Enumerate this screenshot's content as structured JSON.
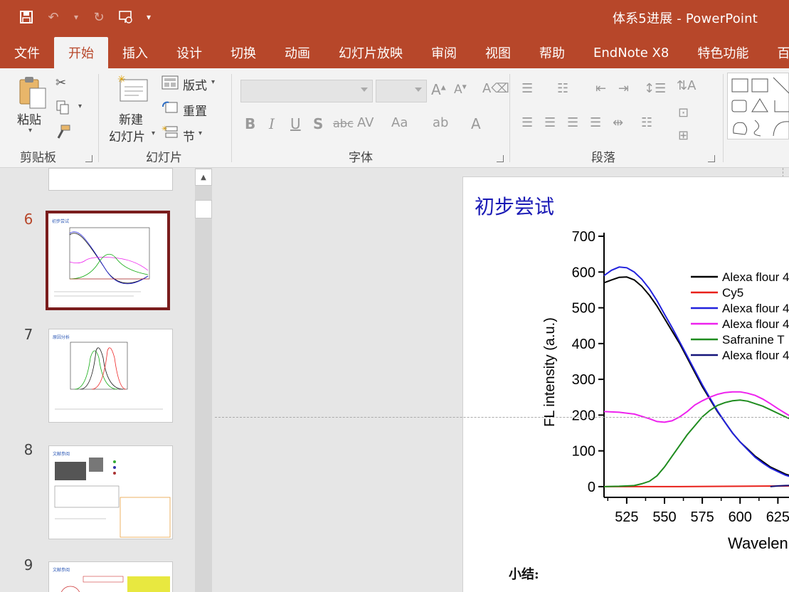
{
  "window": {
    "title": "体系5进展  -  PowerPoint"
  },
  "qat": {
    "icons": [
      "save-icon",
      "undo-icon",
      "redo-icon",
      "slideshow-icon",
      "customize-icon"
    ]
  },
  "tabs": [
    {
      "label": "文件",
      "active": false
    },
    {
      "label": "开始",
      "active": true
    },
    {
      "label": "插入",
      "active": false
    },
    {
      "label": "设计",
      "active": false
    },
    {
      "label": "切换",
      "active": false
    },
    {
      "label": "动画",
      "active": false
    },
    {
      "label": "幻灯片放映",
      "active": false
    },
    {
      "label": "审阅",
      "active": false
    },
    {
      "label": "视图",
      "active": false
    },
    {
      "label": "帮助",
      "active": false
    },
    {
      "label": "EndNote X8",
      "active": false
    },
    {
      "label": "特色功能",
      "active": false
    },
    {
      "label": "百",
      "active": false
    }
  ],
  "ribbon": {
    "clipboard": {
      "label": "剪贴板",
      "paste": "粘贴"
    },
    "slides": {
      "label": "幻灯片",
      "new_slide_1": "新建",
      "new_slide_2": "幻灯片",
      "layout": "版式",
      "reset": "重置",
      "section": "节"
    },
    "font": {
      "label": "字体"
    },
    "paragraph": {
      "label": "段落"
    }
  },
  "thumbnails": [
    {
      "num": "6",
      "title": "初步尝试",
      "selected": true
    },
    {
      "num": "7",
      "title": "原因分析",
      "selected": false
    },
    {
      "num": "8",
      "title": "文献参阅",
      "selected": false
    },
    {
      "num": "9",
      "title": "文献参阅",
      "selected": false
    }
  ],
  "slide": {
    "title": "初步尝试",
    "summary": "小结:"
  },
  "chart_data": {
    "type": "line",
    "ylabel": "FL intensity (a.u.)",
    "xlabel": "Wavelen",
    "x_ticks": [
      525,
      550,
      575,
      600,
      625
    ],
    "y_ticks": [
      0,
      100,
      200,
      300,
      400,
      500,
      600,
      700
    ],
    "xlim": [
      510,
      638
    ],
    "ylim": [
      -30,
      710
    ],
    "legend_position": "top-right",
    "series": [
      {
        "name": "Alexa flour 4",
        "color": "#000000",
        "x": [
          510,
          515,
          520,
          525,
          530,
          535,
          540,
          545,
          550,
          555,
          560,
          565,
          570,
          575,
          580,
          585,
          590,
          595,
          600,
          605,
          610,
          615,
          620,
          625,
          630,
          638
        ],
        "y": [
          570,
          578,
          585,
          586,
          578,
          560,
          535,
          505,
          470,
          435,
          400,
          360,
          320,
          280,
          245,
          210,
          180,
          150,
          125,
          105,
          85,
          70,
          55,
          45,
          35,
          25
        ]
      },
      {
        "name": "Cy5",
        "color": "#e8201a",
        "x": [
          510,
          560,
          600,
          638
        ],
        "y": [
          0,
          0,
          1,
          2
        ]
      },
      {
        "name": "Alexa flour 4",
        "color": "#2222dd",
        "x": [
          510,
          515,
          520,
          525,
          530,
          535,
          540,
          545,
          550,
          555,
          560,
          565,
          570,
          575,
          580,
          585,
          590,
          595,
          600,
          605,
          610,
          615,
          620,
          625,
          630,
          638
        ],
        "y": [
          590,
          605,
          614,
          612,
          600,
          580,
          553,
          520,
          482,
          445,
          405,
          365,
          325,
          285,
          248,
          212,
          180,
          150,
          125,
          103,
          82,
          66,
          52,
          42,
          32,
          22
        ]
      },
      {
        "name": "Alexa flour 4",
        "color": "#ee22ee",
        "x": [
          510,
          520,
          530,
          540,
          545,
          550,
          555,
          560,
          565,
          570,
          575,
          580,
          585,
          590,
          595,
          600,
          605,
          610,
          615,
          620,
          625,
          630,
          638
        ],
        "y": [
          210,
          208,
          203,
          190,
          182,
          180,
          184,
          195,
          210,
          228,
          240,
          250,
          258,
          263,
          265,
          265,
          261,
          255,
          245,
          232,
          218,
          205,
          185
        ]
      },
      {
        "name": "Safranine T",
        "color": "#1f8c1f",
        "x": [
          510,
          520,
          530,
          535,
          540,
          545,
          550,
          555,
          560,
          565,
          570,
          575,
          580,
          585,
          590,
          595,
          600,
          605,
          610,
          615,
          620,
          625,
          630,
          638
        ],
        "y": [
          0,
          1,
          3,
          8,
          15,
          30,
          55,
          85,
          115,
          145,
          170,
          195,
          213,
          227,
          235,
          240,
          242,
          239,
          232,
          225,
          215,
          205,
          195,
          180
        ]
      },
      {
        "name": "Alexa flour 4",
        "color": "#15157a",
        "x": [
          620,
          625,
          630,
          638
        ],
        "y": [
          0,
          2,
          3,
          4
        ]
      }
    ]
  }
}
